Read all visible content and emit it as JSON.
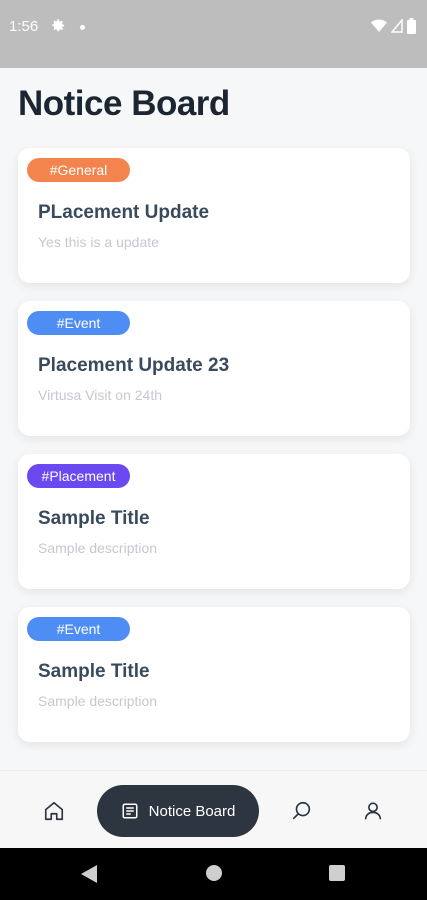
{
  "status_bar": {
    "time": "1:56"
  },
  "page": {
    "title": "Notice Board"
  },
  "notices": [
    {
      "tag": "#General",
      "tag_color": "#f4844e",
      "title": "PLacement Update",
      "description": "Yes this is a update"
    },
    {
      "tag": "#Event",
      "tag_color": "#4e8ef4",
      "title": "Placement Update 23",
      "description": "Virtusa Visit on 24th"
    },
    {
      "tag": "#Placement",
      "tag_color": "#6a49f0",
      "title": "Sample Title",
      "description": "Sample description"
    },
    {
      "tag": "#Event",
      "tag_color": "#4e8ef4",
      "title": "Sample Title",
      "description": "Sample description"
    }
  ],
  "bottom_nav": {
    "items": [
      {
        "icon": "home-icon",
        "label": ""
      },
      {
        "icon": "notice-board-icon",
        "label": "Notice Board",
        "active": true
      },
      {
        "icon": "search-icon",
        "label": ""
      },
      {
        "icon": "profile-icon",
        "label": ""
      }
    ]
  },
  "colors": {
    "active_nav": "#2c3540",
    "title_text": "#1c2633"
  }
}
